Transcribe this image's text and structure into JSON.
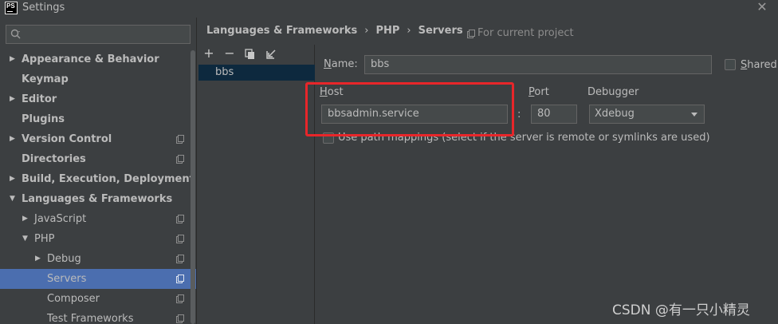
{
  "window": {
    "title": "Settings",
    "logo_text": "PS",
    "close_icon": "close-icon"
  },
  "search": {
    "placeholder": "",
    "value": ""
  },
  "tree": [
    {
      "label": "Appearance & Behavior",
      "bold": true,
      "arrow": "right",
      "project": false
    },
    {
      "label": "Keymap",
      "bold": true,
      "arrow": "",
      "project": false
    },
    {
      "label": "Editor",
      "bold": true,
      "arrow": "right",
      "project": false
    },
    {
      "label": "Plugins",
      "bold": true,
      "arrow": "",
      "project": false
    },
    {
      "label": "Version Control",
      "bold": true,
      "arrow": "right",
      "project": true
    },
    {
      "label": "Directories",
      "bold": true,
      "arrow": "",
      "project": true
    },
    {
      "label": "Build, Execution, Deployment",
      "bold": true,
      "arrow": "right",
      "project": false
    },
    {
      "label": "Languages & Frameworks",
      "bold": true,
      "arrow": "down",
      "project": false
    },
    {
      "label": "JavaScript",
      "bold": false,
      "arrow": "right",
      "project": true
    },
    {
      "label": "PHP",
      "bold": false,
      "arrow": "down",
      "project": true
    },
    {
      "label": "Debug",
      "bold": false,
      "arrow": "right",
      "project": true
    },
    {
      "label": "Servers",
      "bold": false,
      "arrow": "",
      "project": true,
      "selected": true
    },
    {
      "label": "Composer",
      "bold": false,
      "arrow": "",
      "project": true
    },
    {
      "label": "Test Frameworks",
      "bold": false,
      "arrow": "",
      "project": true
    }
  ],
  "breadcrumb": {
    "item1": "Languages & Frameworks",
    "item2": "PHP",
    "item3": "Servers",
    "separator": "›"
  },
  "project_note": "For current project",
  "toolbar": {
    "add": "+",
    "remove": "−",
    "copy_icon": "copy-icon",
    "import_icon": "import-icon"
  },
  "servers": [
    "bbs"
  ],
  "form": {
    "name_label_u": "N",
    "name_label_rest": "ame:",
    "name_value": "bbs",
    "shared_label_u": "S",
    "shared_label_rest": "hared",
    "host_label_u": "H",
    "host_label_rest": "ost",
    "host_value": "bbsadmin.service",
    "port_label_u": "P",
    "port_label_rest": "ort",
    "port_value": "80",
    "port_colon": ":",
    "debugger_label": "Debugger",
    "debugger_value": "Xdebug",
    "path_mappings_label": "Use path mappings (select if the server is remote or symlinks are used)"
  },
  "colors": {
    "highlight": "#e8262a",
    "selection": "#4b6eaf",
    "list_selection": "#0d293e"
  },
  "watermark": "CSDN @有一只小精灵"
}
